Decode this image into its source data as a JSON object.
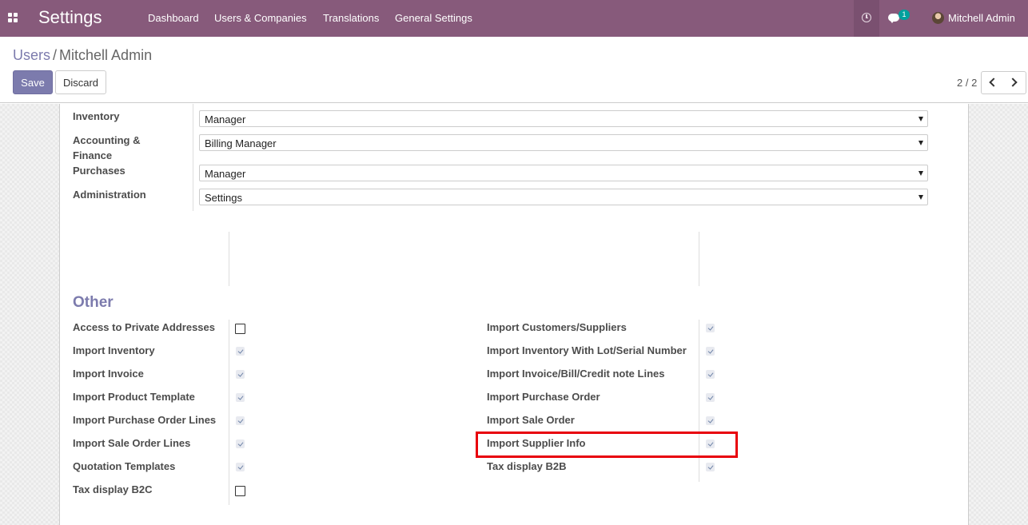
{
  "navbar": {
    "app_title": "Settings",
    "menu": [
      "Dashboard",
      "Users & Companies",
      "Translations",
      "General Settings"
    ],
    "chat_count": "1",
    "user_name": "Mitchell Admin",
    "color": "#875a7b"
  },
  "control_panel": {
    "breadcrumb_parent": "Users",
    "breadcrumb_separator": "/",
    "breadcrumb_current": "Mitchell Admin",
    "save_label": "Save",
    "discard_label": "Discard",
    "pager": "2 / 2"
  },
  "access_rights": [
    {
      "label": "Inventory",
      "value": "Manager"
    },
    {
      "label": "Accounting & Finance",
      "value": "Billing Manager"
    },
    {
      "label": "Purchases",
      "value": "Manager"
    },
    {
      "label": "Administration",
      "value": "Settings"
    }
  ],
  "other": {
    "title": "Other",
    "left": [
      {
        "label": "Access to Private Addresses",
        "checked": false
      },
      {
        "label": "Import Inventory",
        "checked": true
      },
      {
        "label": "Import Invoice",
        "checked": true
      },
      {
        "label": "Import Product Template",
        "checked": true
      },
      {
        "label": "Import Purchase Order Lines",
        "checked": true
      },
      {
        "label": "Import Sale Order Lines",
        "checked": true
      },
      {
        "label": "Quotation Templates",
        "checked": true
      },
      {
        "label": "Tax display B2C",
        "checked": false
      }
    ],
    "right": [
      {
        "label": "Import Customers/Suppliers",
        "checked": true
      },
      {
        "label": "Import Inventory With Lot/Serial Number",
        "checked": true
      },
      {
        "label": "Import Invoice/Bill/Credit note Lines",
        "checked": true
      },
      {
        "label": "Import Purchase Order",
        "checked": true
      },
      {
        "label": "Import Sale Order",
        "checked": true
      },
      {
        "label": "Import Supplier Info",
        "checked": true
      },
      {
        "label": "Tax display B2B",
        "checked": true
      }
    ]
  },
  "colors": {
    "primary": "#7c7bad",
    "highlight": "#e8000b"
  }
}
